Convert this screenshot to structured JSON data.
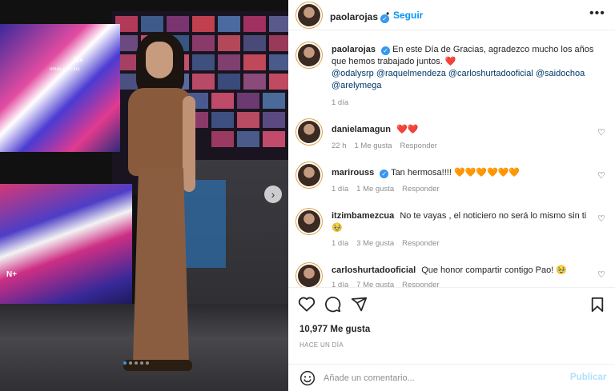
{
  "post": {
    "author": "paolarojas",
    "verified": true,
    "follow_label": "Seguir",
    "more_label": "•••",
    "caption": "En este Día de Gracias, agradezco mucho los años que hemos trabajado juntos.",
    "caption_emoji": "❤️",
    "mentions": [
      "@odalysrp",
      "@raquelmendeza",
      "@carloshurtadooficial",
      "@saidochoa",
      "@arelymega"
    ],
    "caption_time": "1 día",
    "likes": "10,977 Me gusta",
    "time_ago": "HACE UN DÍA"
  },
  "photo": {
    "overlay_text_1": "nmas.com.mx",
    "overlay_text_2": "N+",
    "overlay_text_3": "N+",
    "slides_total": 5,
    "slide_active": 1
  },
  "comments": [
    {
      "username": "danielamagun",
      "verified": false,
      "text": "",
      "emoji": "❤️❤️",
      "time": "22 h",
      "likes": "1 Me gusta",
      "reply": "Responder"
    },
    {
      "username": "marirouss",
      "verified": true,
      "text": "Tan hermosa!!!!",
      "emoji": "🧡🧡🧡🧡🧡🧡",
      "time": "1 día",
      "likes": "1 Me gusta",
      "reply": "Responder"
    },
    {
      "username": "itzimbamezcua",
      "verified": false,
      "text": "No te vayas , el noticiero no será lo mismo sin ti",
      "emoji": "🥹",
      "time": "1 día",
      "likes": "3 Me gusta",
      "reply": "Responder"
    },
    {
      "username": "carloshurtadooficial",
      "verified": false,
      "text": "Que honor compartir contigo Pao!",
      "emoji": "🥹",
      "time": "1 día",
      "likes": "7 Me gusta",
      "reply": "Responder"
    }
  ],
  "composer": {
    "placeholder": "Añade un comentario...",
    "publish_label": "Publicar"
  },
  "icons": {
    "like": "heart-icon",
    "comment": "comment-bubble-icon",
    "share": "paper-plane-icon",
    "save": "bookmark-icon",
    "emoji": "smiley-icon",
    "next": "chevron-right-icon"
  },
  "colors": {
    "link": "#0095f6",
    "mention": "#00376b",
    "muted": "#8e8e8e",
    "verified": "#3897f0",
    "publish_disabled": "#b2dffc"
  }
}
